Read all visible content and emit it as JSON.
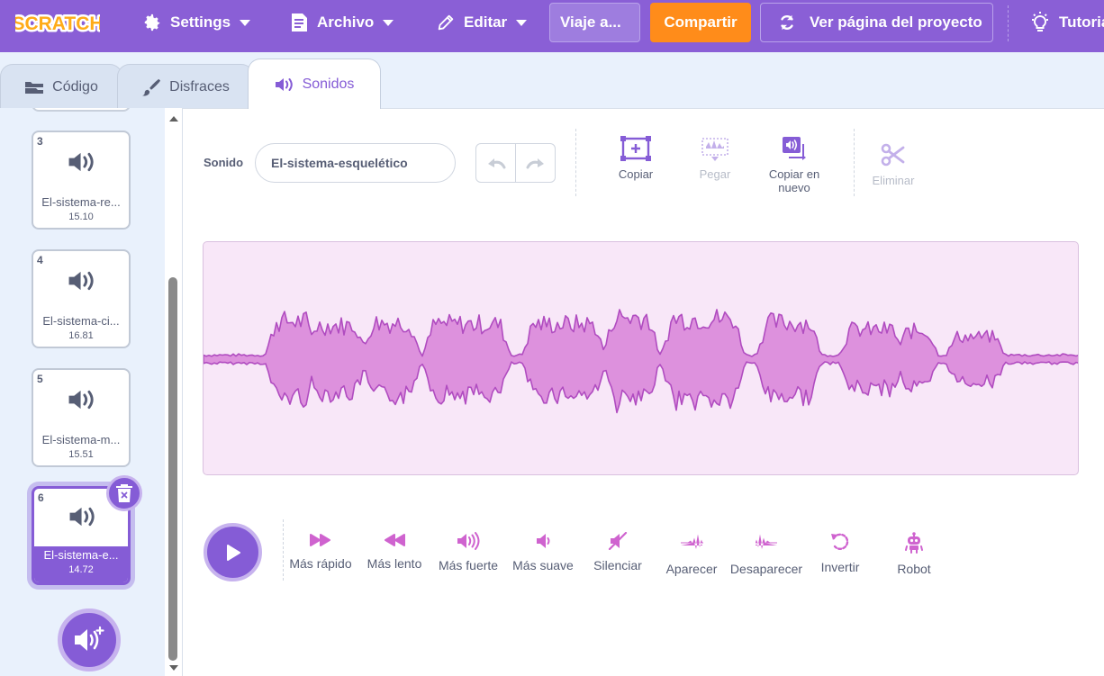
{
  "menubar": {
    "logo_text": "SCRATCH",
    "settings": "Settings",
    "file": "Archivo",
    "edit": "Editar",
    "project_title": "Viaje a...",
    "share": "Compartir",
    "project_page": "Ver página del proyecto",
    "tutorials": "Tutoriales"
  },
  "tabs": {
    "code": "Código",
    "costumes": "Disfraces",
    "sounds": "Sonidos"
  },
  "sounds": [
    {
      "num": "3",
      "name": "El-sistema-re...",
      "duration": "15.10"
    },
    {
      "num": "4",
      "name": "El-sistema-ci...",
      "duration": "16.81"
    },
    {
      "num": "5",
      "name": "El-sistema-m...",
      "duration": "15.51"
    },
    {
      "num": "6",
      "name": "El-sistema-e...",
      "duration": "14.72"
    }
  ],
  "editor": {
    "sound_label": "Sonido",
    "sound_name": "El-sistema-esquelético",
    "copy": "Copiar",
    "paste": "Pegar",
    "copy_new_1": "Copiar en",
    "copy_new_2": "nuevo",
    "delete": "Eliminar"
  },
  "effects": {
    "faster": "Más rápido",
    "slower": "Más lento",
    "louder": "Más fuerte",
    "softer": "Más suave",
    "mute": "Silenciar",
    "fade_in": "Aparecer",
    "fade_out": "Desaparecer",
    "reverse": "Invertir",
    "robot": "Robot"
  },
  "colors": {
    "menubar": "#8a5fd6",
    "accent": "#855cd6",
    "share": "#ff8c1a",
    "waveform_fill": "#dd91dd",
    "waveform_stroke": "#b04cc0",
    "effect_icon": "#cf63cf"
  }
}
